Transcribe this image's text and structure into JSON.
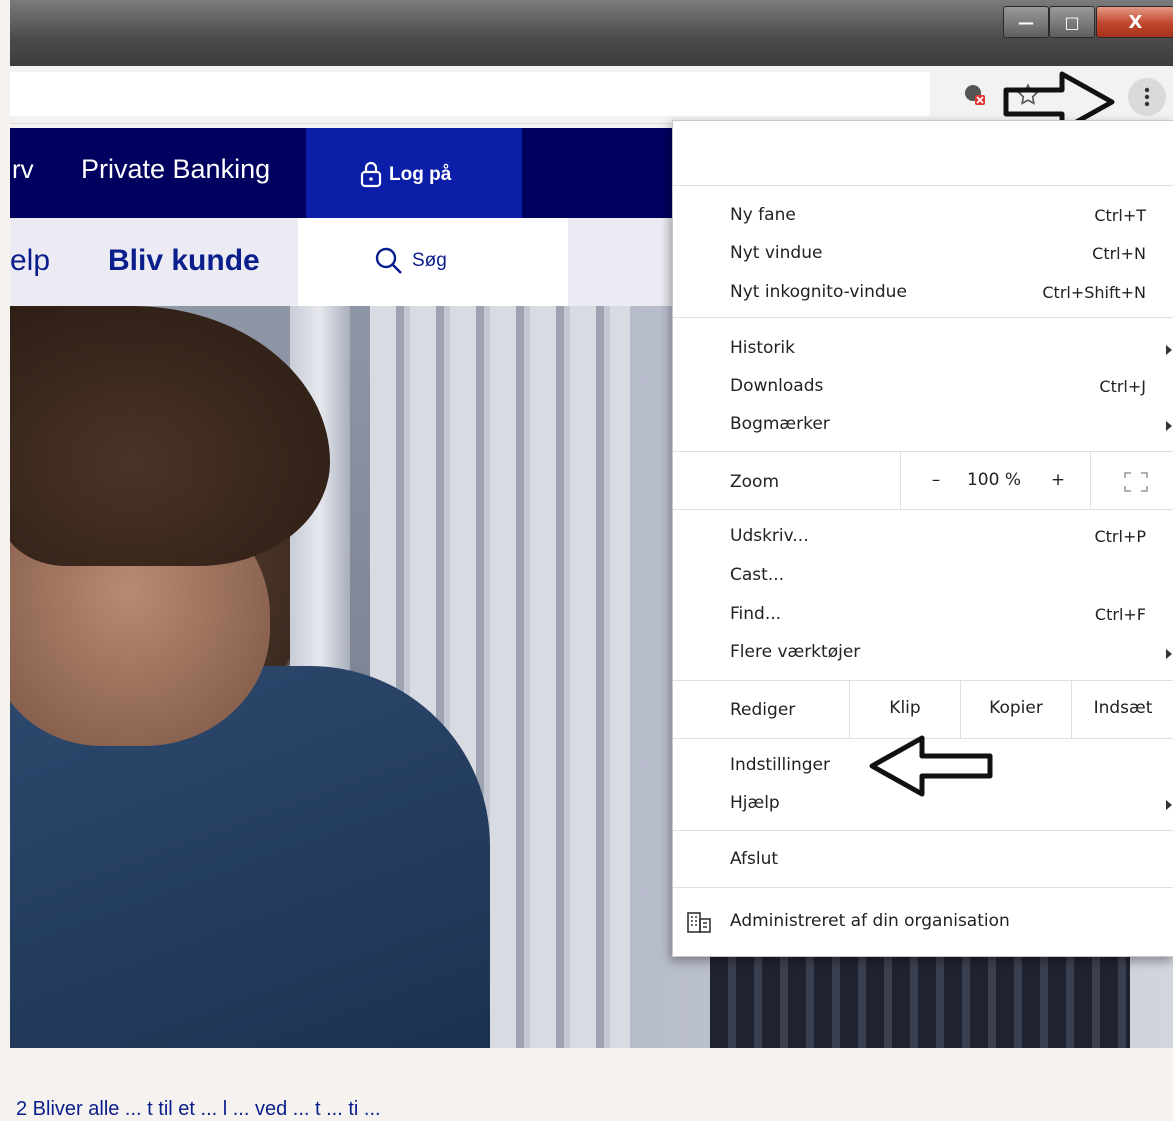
{
  "window": {
    "minimize_label": "—",
    "maximize_label": "□",
    "close_label": "X"
  },
  "site": {
    "nav_top_partial": "rv",
    "private_banking": "Private Banking",
    "login": "Log på",
    "nav_second_partial": "elp",
    "become_customer": "Bliv kunde",
    "search": "Søg",
    "bottom_text": "2 Bliver alle ... t til et ... l ... ved ... t ... ti ..."
  },
  "menu": {
    "new_tab": "Ny fane",
    "new_tab_sc": "Ctrl+T",
    "new_window": "Nyt vindue",
    "new_window_sc": "Ctrl+N",
    "incognito": "Nyt inkognito-vindue",
    "incognito_sc": "Ctrl+Shift+N",
    "history": "Historik",
    "downloads": "Downloads",
    "downloads_sc": "Ctrl+J",
    "bookmarks": "Bogmærker",
    "zoom": "Zoom",
    "zoom_minus": "–",
    "zoom_value": "100 %",
    "zoom_plus": "+",
    "print": "Udskriv...",
    "print_sc": "Ctrl+P",
    "cast": "Cast...",
    "find": "Find...",
    "find_sc": "Ctrl+F",
    "more_tools": "Flere værktøjer",
    "edit": "Rediger",
    "cut": "Klip",
    "copy": "Kopier",
    "paste": "Indsæt",
    "settings": "Indstillinger",
    "help": "Hjælp",
    "exit": "Afslut",
    "managed": "Administreret af din organisation"
  },
  "colors": {
    "nav_dark": "#00005f",
    "login_box": "#0a1ea8",
    "link_blue": "#0a1e8c"
  },
  "icons": [
    "location-blocked-icon",
    "star-icon",
    "menu-kebab-icon",
    "lock-icon",
    "search-icon",
    "building-icon",
    "fullscreen-icon",
    "annotation-arrow-icon"
  ]
}
